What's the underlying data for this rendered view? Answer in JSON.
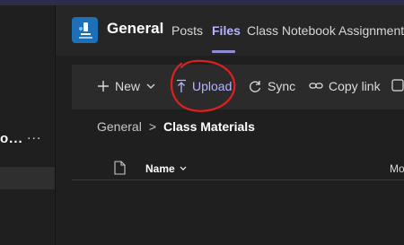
{
  "left_pane": {
    "truncated_text": "o...",
    "more": "..."
  },
  "header": {
    "team": "General",
    "tabs": [
      {
        "label": "Posts",
        "active": false
      },
      {
        "label": "Files",
        "active": true
      },
      {
        "label": "Class Notebook",
        "active": false
      },
      {
        "label": "Assignments",
        "active": false
      }
    ]
  },
  "toolbar": {
    "new_label": "New",
    "upload_label": "Upload",
    "sync_label": "Sync",
    "copy_link_label": "Copy link"
  },
  "breadcrumb": {
    "home": "General",
    "separator": ">",
    "current": "Class Materials"
  },
  "list": {
    "name_header": "Name",
    "modified_header": "Mo"
  },
  "colors": {
    "accent": "#b6b5ff",
    "annotation": "#e02020",
    "team_logo": "#1d6fb8"
  }
}
